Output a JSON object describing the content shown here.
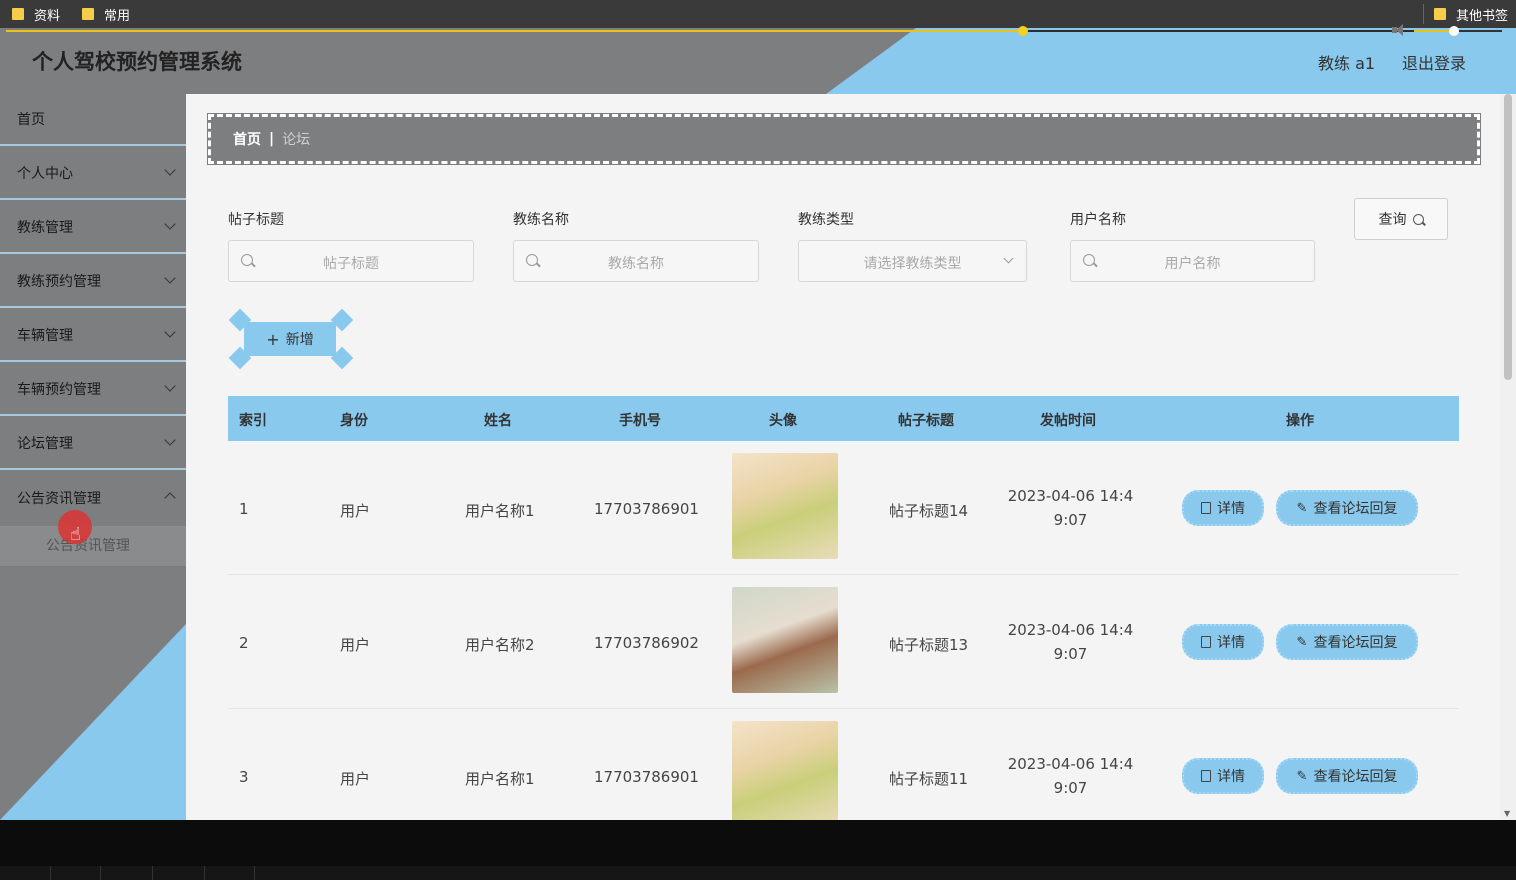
{
  "bookmarks": {
    "items": [
      "资料",
      "常用"
    ],
    "right": "其他书签"
  },
  "header": {
    "title": "个人驾校预约管理系统",
    "user": "教练 a1",
    "logout": "退出登录"
  },
  "sidebar": {
    "items": [
      {
        "label": "首页"
      },
      {
        "label": "个人中心"
      },
      {
        "label": "教练管理"
      },
      {
        "label": "教练预约管理"
      },
      {
        "label": "车辆管理"
      },
      {
        "label": "车辆预约管理"
      },
      {
        "label": "论坛管理"
      },
      {
        "label": "公告资讯管理"
      }
    ],
    "sub_item": "公告资讯管理"
  },
  "breadcrumb": {
    "home": "首页",
    "separator": "|",
    "current": "论坛"
  },
  "search": {
    "fields": [
      {
        "label": "帖子标题",
        "placeholder": "帖子标题"
      },
      {
        "label": "教练名称",
        "placeholder": "教练名称"
      },
      {
        "label": "教练类型",
        "placeholder": "请选择教练类型"
      },
      {
        "label": "用户名称",
        "placeholder": "用户名称"
      }
    ],
    "query_button": "查询"
  },
  "add_button": "新增",
  "table": {
    "headers": [
      "索引",
      "身份",
      "姓名",
      "手机号",
      "头像",
      "帖子标题",
      "发帖时间",
      "操作"
    ],
    "rows": [
      {
        "index": "1",
        "role": "用户",
        "name": "用户名称1",
        "phone": "17703786901",
        "title": "帖子标题14",
        "time1": "2023-04-06 14:4",
        "time2": "9:07",
        "detail": "详情",
        "reply": "查看论坛回复"
      },
      {
        "index": "2",
        "role": "用户",
        "name": "用户名称2",
        "phone": "17703786902",
        "title": "帖子标题13",
        "time1": "2023-04-06 14:4",
        "time2": "9:07",
        "detail": "详情",
        "reply": "查看论坛回复"
      },
      {
        "index": "3",
        "role": "用户",
        "name": "用户名称1",
        "phone": "17703786901",
        "title": "帖子标题11",
        "time1": "2023-04-06 14:4",
        "time2": "9:07",
        "detail": "详情",
        "reply": "查看论坛回复"
      }
    ]
  },
  "player": {
    "progress": 0.68,
    "volume": 0.45
  },
  "colors": {
    "accent": "#89c9ee",
    "gray": "#7d7e80",
    "progress": "#e9c21c"
  },
  "icons": [
    "folder-icon",
    "search-icon",
    "chevron-down-icon",
    "plus-icon",
    "document-icon",
    "edit-icon",
    "volume-icon"
  ]
}
